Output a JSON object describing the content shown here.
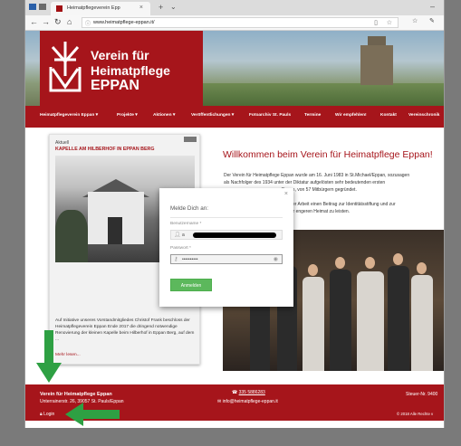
{
  "browser": {
    "tab_title": "Heimatpflegeverein Epp",
    "tab_close": "×",
    "new_tab": "+",
    "tab_dropdown": "⌄",
    "window_min": "–",
    "url": "www.heimatpflege-eppan.it/"
  },
  "site": {
    "logo_lines": [
      "Verein für",
      "Heimatpflege",
      "EPPAN"
    ],
    "menu": [
      "Heimatpflegeverein Eppan ▾",
      "Projekte ▾",
      "Aktionen ▾",
      "Veröffentlichungen ▾",
      "Fotoarchiv St. Pauls",
      "Termine",
      "Wir empfehlen!",
      "Kontakt",
      "Vereinschronik"
    ],
    "sidebar": {
      "category": "Aktuell",
      "title": "KAPELLE AM HILBERHOF IN EPPAN BERG",
      "text": "Auf Initiative unseres Vorstandmitgliedes Christof Frank beschloss der Heimatpflegeverein Eppan Ende 2017 die dringend notwendige Renovierung der kleinen Kapelle beim Hilberhof in Eppan Berg, auf dem ...",
      "more": "Mehr lesen..."
    },
    "welcome_title": "Willkommen beim Verein für Heimatpflege Eppan!",
    "para1_line1": "Der Verein für Heimatpflege Eppan wurde am 16. Juni 1983 in St.Michael/Eppan, sozusagen",
    "para1_line2": "als Nachfolger des 1934 unter der Diktatur aufgelösten sehr bedeutenden ersten",
    "para1_line3": "Eppan, von 57 Mitbürgern gegründet.",
    "para2_line1": "t seiner Arbeit einen Beitrag zur Identitätsstiftung und zur",
    "para2_line2": "tät der engeren Heimat zu leisten."
  },
  "modal": {
    "close": "×",
    "title": "Melde Dich an:",
    "username_label": "Benutzername *",
    "username_value": "a",
    "password_label": "Passwort *",
    "password_value": "••••••••••",
    "submit": "Anmelden"
  },
  "footer": {
    "org": "Verein für Heimatpflege Eppan",
    "address": "Unterrainerstr. 26, 39057 St. Pauls/Eppan",
    "login": "Login",
    "phone": "335 5886283",
    "email": "info@heimatpflege-eppan.it",
    "tax": "Steuer-Nr. 9400",
    "copyright": "© 2018 Alle Rechte v"
  },
  "colors": {
    "brand": "#a6151b",
    "button": "#5cb85c",
    "arrow": "#2ea043"
  }
}
